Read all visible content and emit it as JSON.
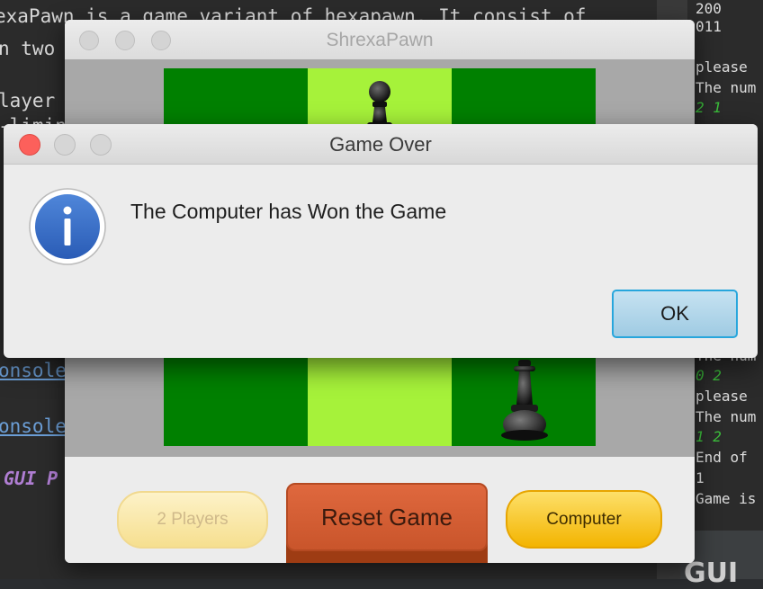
{
  "background_editor": {
    "lines": [
      "exaPawn is a game variant of hexapawn. It consist of",
      "n two",
      "layer",
      "-limin",
      "onsole",
      "onsole",
      "GUI P"
    ]
  },
  "background_console": {
    "lines": [
      "200",
      "011",
      "please",
      "The num",
      "2 1",
      "The num",
      "0 2",
      "please",
      "The num",
      "1 2",
      "End of",
      "1",
      "Game is"
    ],
    "bottom_label": "GUI"
  },
  "game_window": {
    "title": "ShrexaPawn",
    "board": {
      "colors": {
        "dark": "#008000",
        "light": "#a6f23a",
        "frame": "#a8a8a8"
      },
      "pieces": [
        {
          "type": "pawn",
          "color": "black",
          "row": 0,
          "col": 1
        },
        {
          "type": "pawn",
          "color": "black",
          "row": 2,
          "col": 2
        }
      ]
    },
    "buttons": {
      "two_players": "2 Players",
      "reset": "Reset Game",
      "computer": "Computer"
    }
  },
  "dialog": {
    "title": "Game Over",
    "icon": "info-icon",
    "message": "The Computer has Won the Game",
    "ok": "OK",
    "accent_color": "#27a6dc"
  }
}
